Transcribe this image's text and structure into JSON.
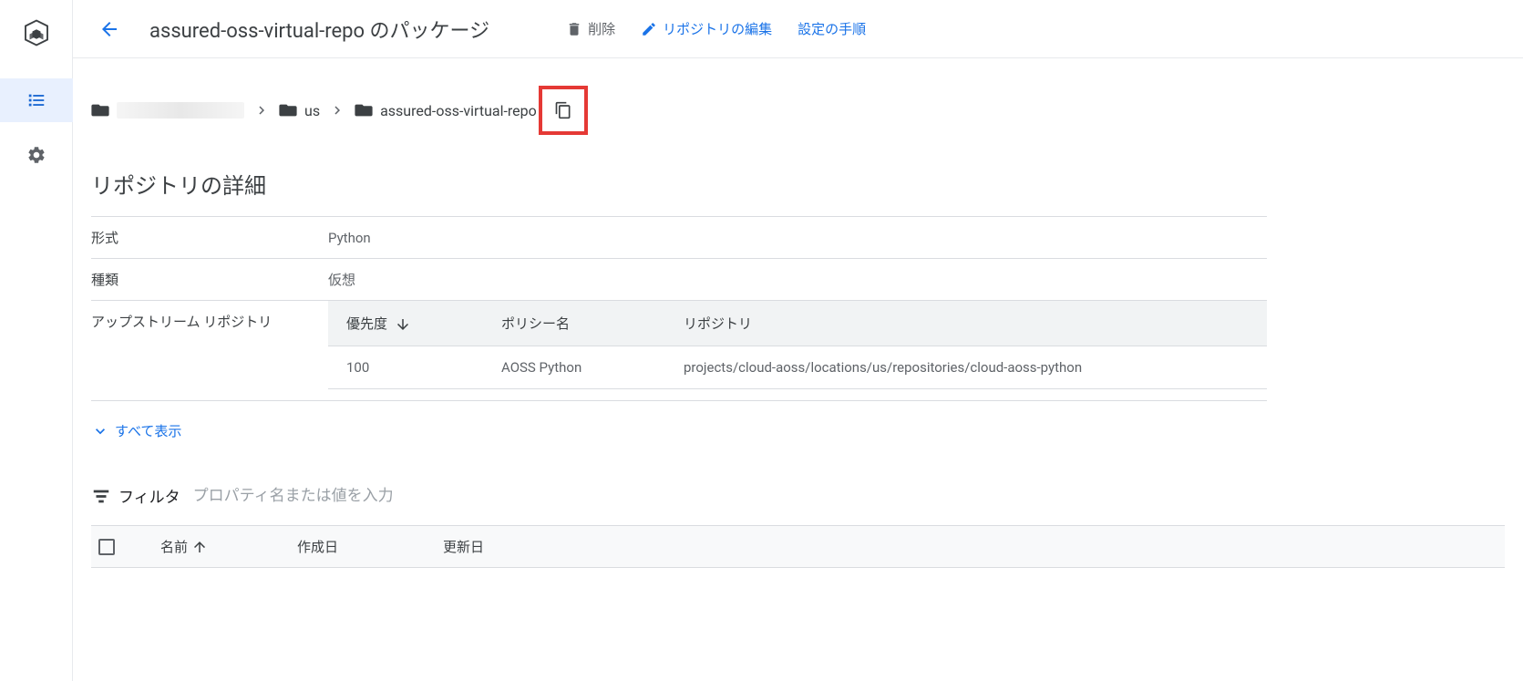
{
  "header": {
    "page_title": "assured-oss-virtual-repo のパッケージ",
    "delete_label": "削除",
    "edit_label": "リポジトリの編集",
    "setup_label": "設定の手順"
  },
  "breadcrumb": {
    "us_label": "us",
    "repo_label": "assured-oss-virtual-repo"
  },
  "details": {
    "section_title": "リポジトリの詳細",
    "format_label": "形式",
    "format_value": "Python",
    "type_label": "種類",
    "type_value": "仮想",
    "upstream_label": "アップストリーム リポジトリ",
    "upstream_headers": {
      "priority": "優先度",
      "policy": "ポリシー名",
      "repo": "リポジトリ"
    },
    "upstream_rows": [
      {
        "priority": "100",
        "policy": "AOSS Python",
        "repo": "projects/cloud-aoss/locations/us/repositories/cloud-aoss-python"
      }
    ],
    "show_all_label": "すべて表示"
  },
  "filter": {
    "label": "フィルタ",
    "placeholder": "プロパティ名または値を入力"
  },
  "packages": {
    "name_col": "名前",
    "created_col": "作成日",
    "updated_col": "更新日"
  }
}
